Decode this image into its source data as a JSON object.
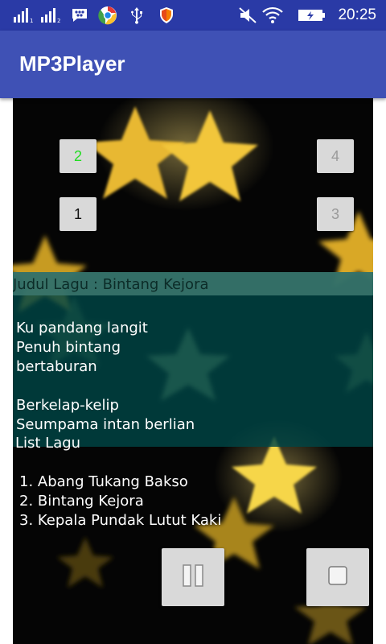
{
  "status_bar": {
    "time": "20:25",
    "icons": [
      "signal-1-icon",
      "signal-2-icon",
      "bbm-icon",
      "chrome-icon",
      "usb-icon",
      "shield-icon",
      "mute-icon",
      "wifi-icon",
      "battery-icon"
    ]
  },
  "app_bar": {
    "title": "MP3Player"
  },
  "track_buttons": {
    "b1": "1",
    "b2": "2",
    "b3": "3",
    "b4": "4"
  },
  "now_playing": {
    "title": "Judul Lagu : Bintang Kejora",
    "lyrics": "Ku pandang langit\nPenuh bintang\nbertaburan\n\nBerkelap-kelip\nSeumpama intan berlian"
  },
  "playlist": {
    "heading": "List Lagu",
    "items": [
      "1. Abang Tukang Bakso",
      "2. Bintang Kejora",
      "3. Kepala Pundak Lutut Kaki"
    ]
  },
  "controls": {
    "pause_icon": "pause-icon",
    "stop_icon": "stop-icon"
  },
  "colors": {
    "status_bar": "#2a3aa6",
    "app_bar": "#3f51b5",
    "active_track": "#22dd22",
    "disabled_track": "#9a9a9a",
    "star": "#f0c83a"
  }
}
